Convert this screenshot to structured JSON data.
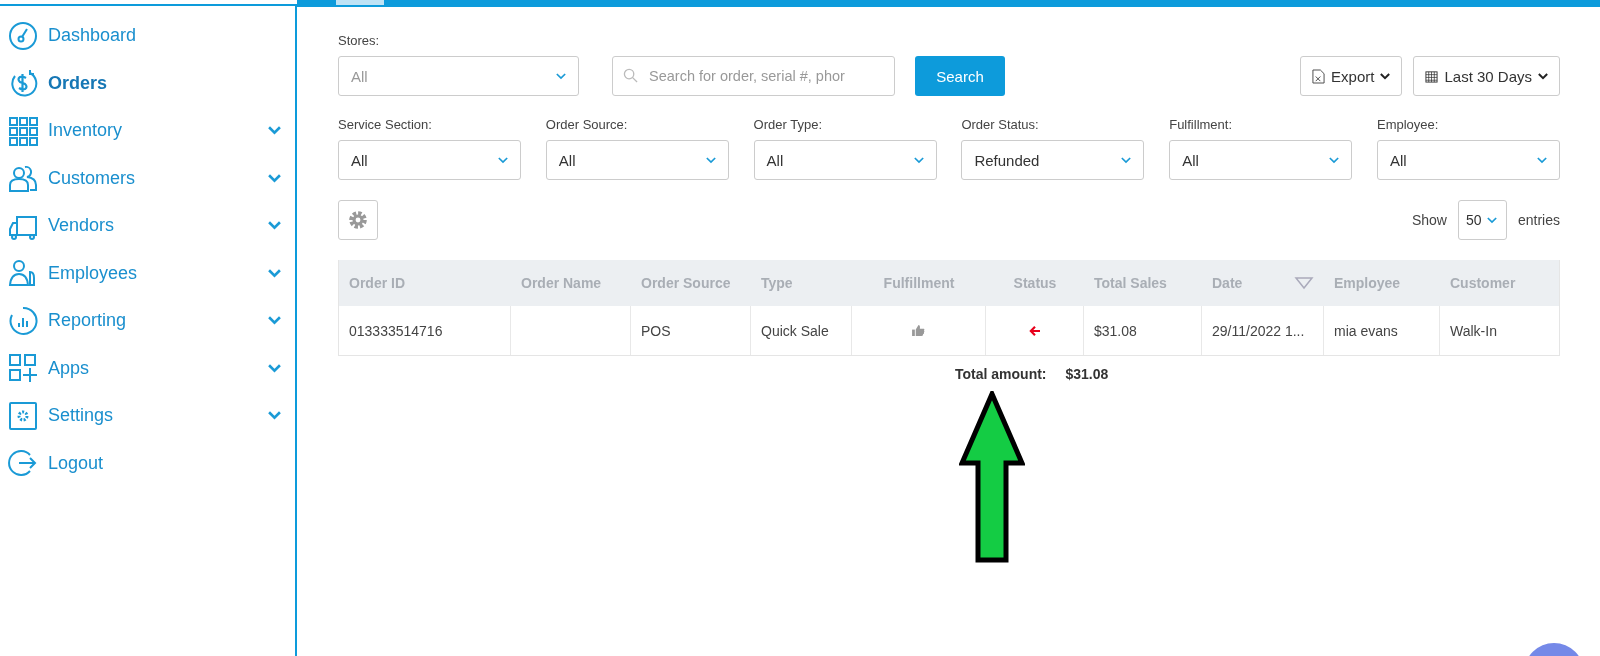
{
  "sidebar": {
    "items": [
      {
        "label": "Dashboard",
        "selected": false,
        "expandable": false
      },
      {
        "label": "Orders",
        "selected": true,
        "expandable": false
      },
      {
        "label": "Inventory",
        "selected": false,
        "expandable": true
      },
      {
        "label": "Customers",
        "selected": false,
        "expandable": true
      },
      {
        "label": "Vendors",
        "selected": false,
        "expandable": true
      },
      {
        "label": "Employees",
        "selected": false,
        "expandable": true
      },
      {
        "label": "Reporting",
        "selected": false,
        "expandable": true
      },
      {
        "label": "Apps",
        "selected": false,
        "expandable": true
      },
      {
        "label": "Settings",
        "selected": false,
        "expandable": true
      },
      {
        "label": "Logout",
        "selected": false,
        "expandable": false
      }
    ]
  },
  "stores": {
    "label": "Stores:",
    "placeholder": "All"
  },
  "search": {
    "placeholder": "Search for order, serial #, phor",
    "button": "Search"
  },
  "toolbar": {
    "export": "Export",
    "date_range": "Last 30 Days"
  },
  "filters": [
    {
      "label": "Service Section:",
      "value": "All"
    },
    {
      "label": "Order Source:",
      "value": "All"
    },
    {
      "label": "Order Type:",
      "value": "All"
    },
    {
      "label": "Order Status:",
      "value": "Refunded"
    },
    {
      "label": "Fulfillment:",
      "value": "All"
    },
    {
      "label": "Employee:",
      "value": "All"
    }
  ],
  "page_size": {
    "label_before": "Show",
    "value": "50",
    "label_after": "entries"
  },
  "table": {
    "columns": [
      {
        "label": "Order ID",
        "sortable": false
      },
      {
        "label": "Order Name",
        "sortable": false
      },
      {
        "label": "Order Source",
        "sortable": false
      },
      {
        "label": "Type",
        "sortable": false
      },
      {
        "label": "Fulfillment",
        "sortable": false
      },
      {
        "label": "Status",
        "sortable": false
      },
      {
        "label": "Total Sales",
        "sortable": false
      },
      {
        "label": "Date",
        "sortable": true
      },
      {
        "label": "Employee",
        "sortable": false
      },
      {
        "label": "Customer",
        "sortable": false
      }
    ],
    "rows": [
      {
        "cells": [
          {
            "kind": "text",
            "text": "013333514716"
          },
          {
            "kind": "empty"
          },
          {
            "kind": "text",
            "text": "POS"
          },
          {
            "kind": "text",
            "text": "Quick Sale"
          },
          {
            "kind": "icon"
          },
          {
            "kind": "icon"
          },
          {
            "kind": "text",
            "text": "$31.08"
          },
          {
            "kind": "text",
            "text": "29/11/2022 1..."
          },
          {
            "kind": "text",
            "text": "mia evans"
          },
          {
            "kind": "text",
            "text": "Walk-In"
          }
        ]
      }
    ],
    "total": {
      "label": "Total amount:",
      "value": "$31.08"
    }
  }
}
